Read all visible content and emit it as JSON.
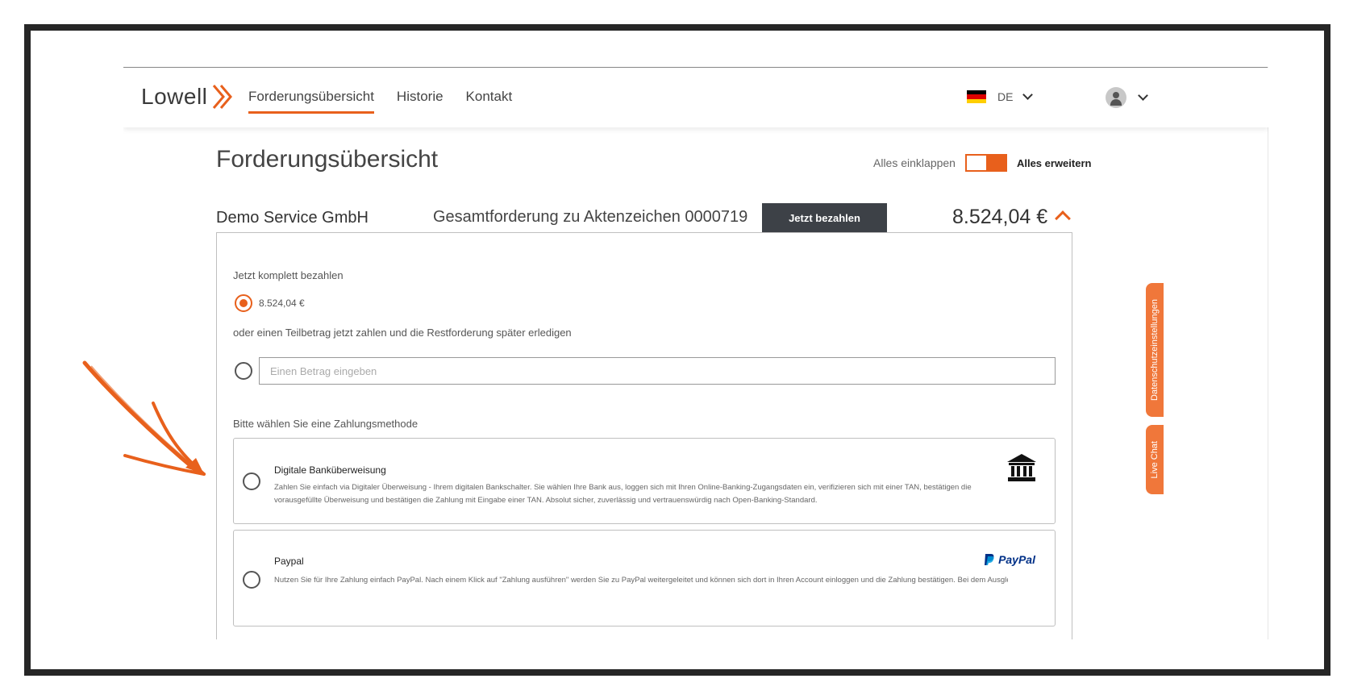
{
  "header": {
    "logo_text": "Lowell",
    "nav": [
      {
        "label": "Forderungsübersicht",
        "active": true
      },
      {
        "label": "Historie",
        "active": false
      },
      {
        "label": "Kontakt",
        "active": false
      }
    ],
    "language": "DE"
  },
  "page": {
    "title": "Forderungsübersicht",
    "collapse_label": "Alles einklappen",
    "expand_label": "Alles erweitern"
  },
  "claim": {
    "creditor": "Demo Service GmbH",
    "label": "Gesamtforderung zu Aktenzeichen 0000719",
    "pay_button": "Jetzt bezahlen",
    "amount": "8.524,04 €"
  },
  "payment": {
    "full_label": "Jetzt komplett bezahlen",
    "full_amount": "8.524,04 €",
    "partial_label": "oder einen Teilbetrag jetzt zahlen und die Restforderung später erledigen",
    "amount_placeholder": "Einen Betrag eingeben",
    "method_prompt": "Bitte wählen Sie eine Zahlungsmethode",
    "methods": [
      {
        "title": "Digitale Banküberweisung",
        "description": "Zahlen Sie einfach via Digitaler Überweisung - Ihrem digitalen Bankschalter. Sie wählen Ihre Bank aus, loggen sich mit Ihren Online-Banking-Zugangsdaten ein, verifizieren sich mit einer TAN, bestätigen die vorausgefüllte Überweisung und bestätigen die Zahlung mit Eingabe einer TAN. Absolut sicher, zuverlässig und vertrauenswürdig nach Open-Banking-Standard.",
        "icon": "bank-icon"
      },
      {
        "title": "Paypal",
        "description": "Nutzen Sie für Ihre Zahlung einfach PayPal. Nach einem Klick auf \"Zahlung ausführen\" werden Sie zu PayPal weitergeleitet und können sich dort in Ihren Account einloggen und die Zahlung bestätigen. Bei dem Ausgleich einer",
        "logo_text": "PayPal",
        "icon": "paypal-icon"
      }
    ]
  },
  "side_tabs": {
    "privacy": "Datenschutzeinstellungen",
    "chat": "Live Chat"
  },
  "colors": {
    "accent": "#e8601c",
    "button_dark": "#3d4147",
    "frame": "#262626",
    "paypal_dark": "#003087",
    "paypal_light": "#009cde"
  }
}
